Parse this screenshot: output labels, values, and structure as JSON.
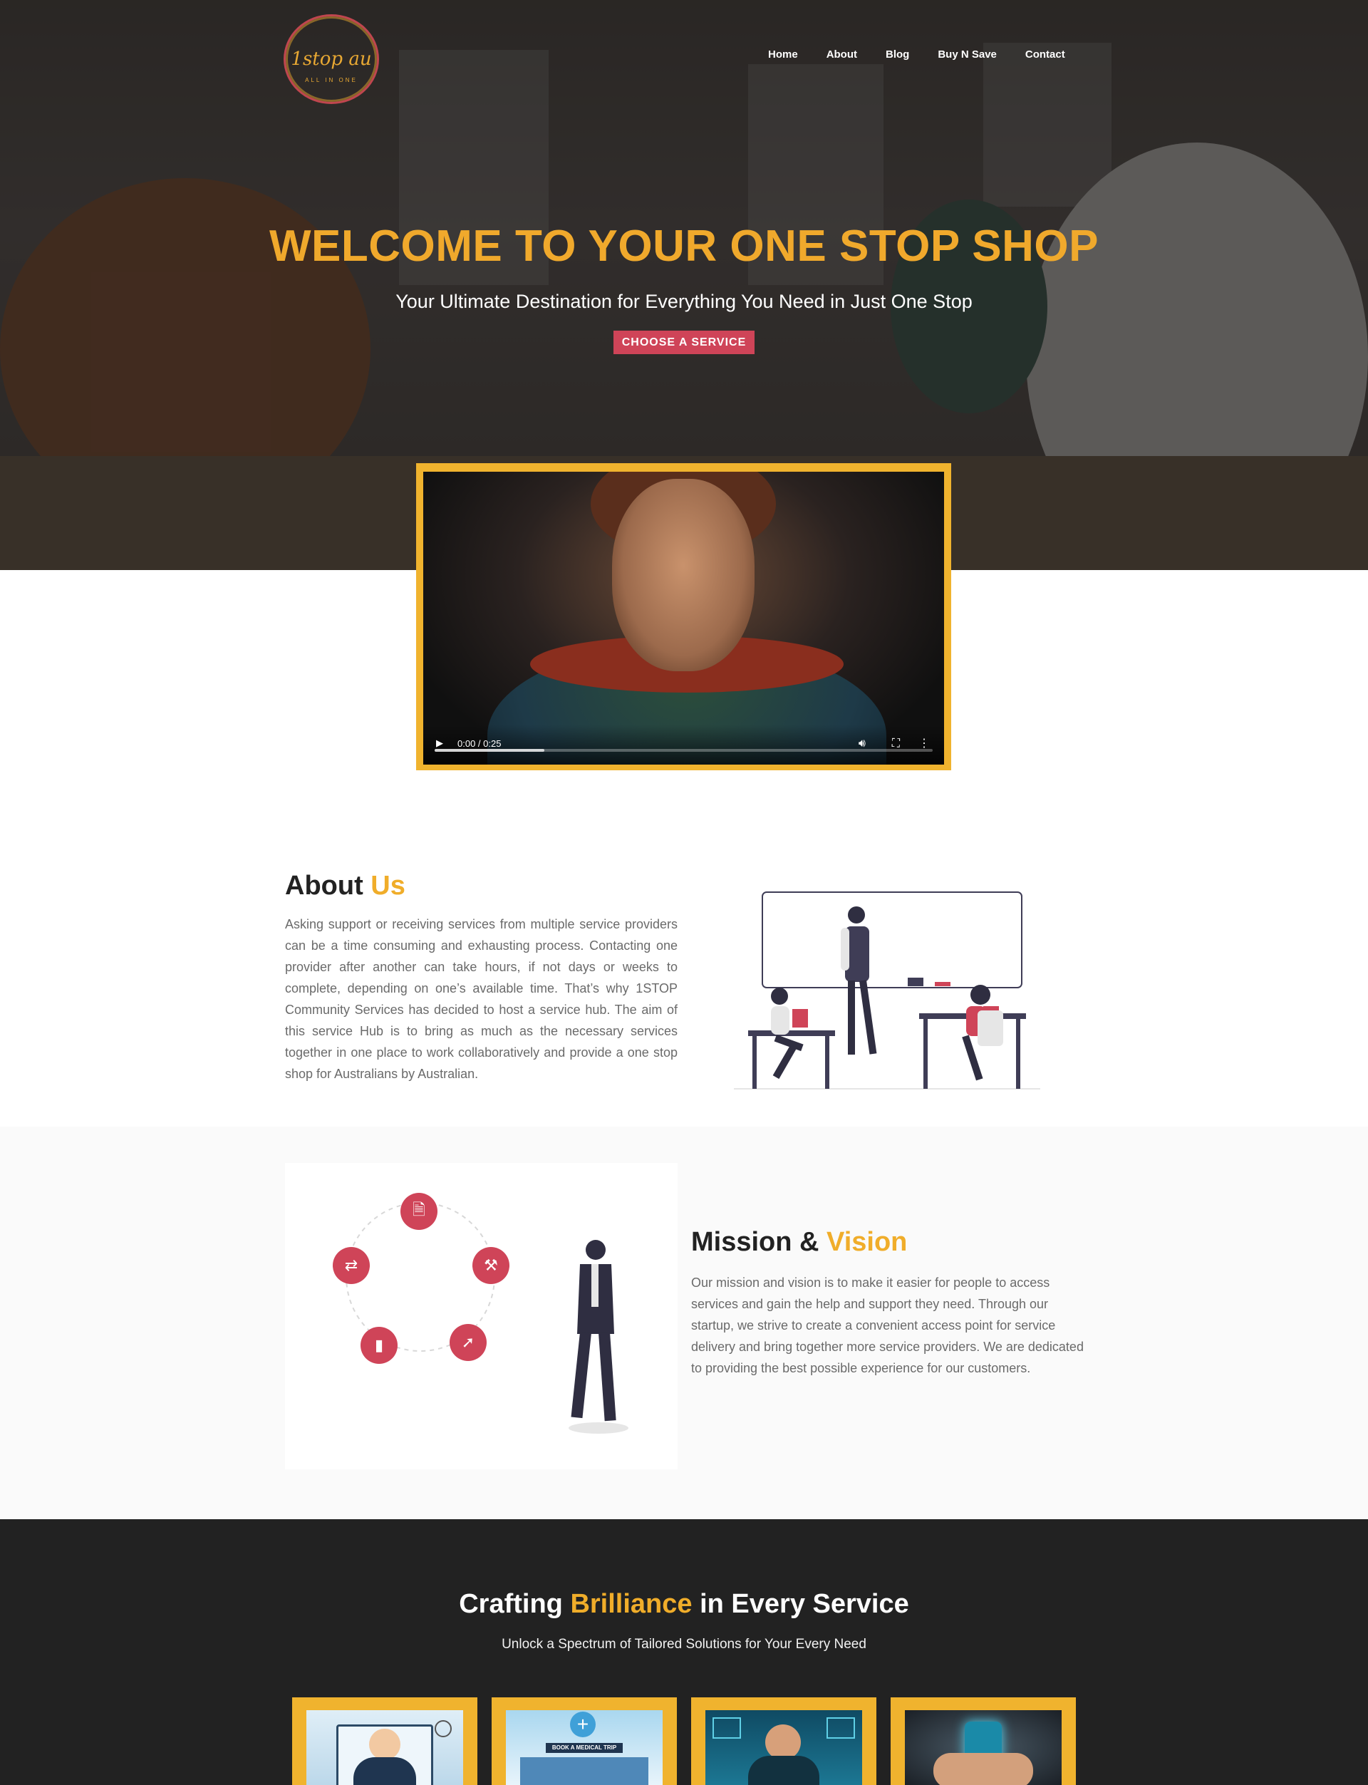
{
  "nav": {
    "logo_text": "1stop au",
    "logo_sub": "ALL IN ONE",
    "items": [
      {
        "label": "Home"
      },
      {
        "label": "About"
      },
      {
        "label": "Blog"
      },
      {
        "label": "Buy N Save"
      },
      {
        "label": "Contact"
      }
    ]
  },
  "hero": {
    "title": "WELCOME TO YOUR ONE STOP SHOP",
    "subtitle": "Your Ultimate Destination for Everything You Need in Just One Stop",
    "cta_label": "CHOOSE A SERVICE"
  },
  "video": {
    "time": "0:00 / 0:25",
    "play_icon": "play-icon",
    "volume_icon": "volume-icon",
    "fullscreen_icon": "fullscreen-icon",
    "more_icon": "more-vert-icon",
    "buffered_fraction": 0.22
  },
  "about": {
    "title_main": "About ",
    "title_accent": "Us",
    "body": "Asking support or receiving services from multiple service providers can be a time consuming and exhausting process. Contacting one provider after another can take hours, if not days or weeks to complete, depending on one’s available time. That’s why 1STOP Community Services has decided to host a service hub. The aim of this service Hub is to bring as much as the necessary services together in one place to work collaboratively and provide a one stop shop for Australians by Australian."
  },
  "mission": {
    "title_main": "Mission & ",
    "title_accent": "Vision",
    "body": "Our mission and vision is to make it easier for people to access services and gain the help and support they need. Through our startup, we strive to create a convenient access point for service delivery and bring together more service providers. We are dedicated to providing the best possible experience for our customers.",
    "icons": [
      "document-icon",
      "hammer-icon",
      "rocket-icon",
      "bar-chart-icon",
      "repeat-icon"
    ]
  },
  "services": {
    "title_pre": "Crafting ",
    "title_accent": "Brilliance",
    "title_post": " in Every Service",
    "subtitle": "Unlock a Spectrum of Tailored Solutions for Your Every Need",
    "cards": [
      {
        "name": "service-card-business"
      },
      {
        "name": "service-card-medical",
        "sign": "BOOK A MEDICAL TRIP"
      },
      {
        "name": "service-card-support"
      },
      {
        "name": "service-card-mobile"
      }
    ]
  },
  "colors": {
    "accent": "#f0ad2a",
    "brand_red": "#cf4458",
    "dark": "#222222"
  }
}
